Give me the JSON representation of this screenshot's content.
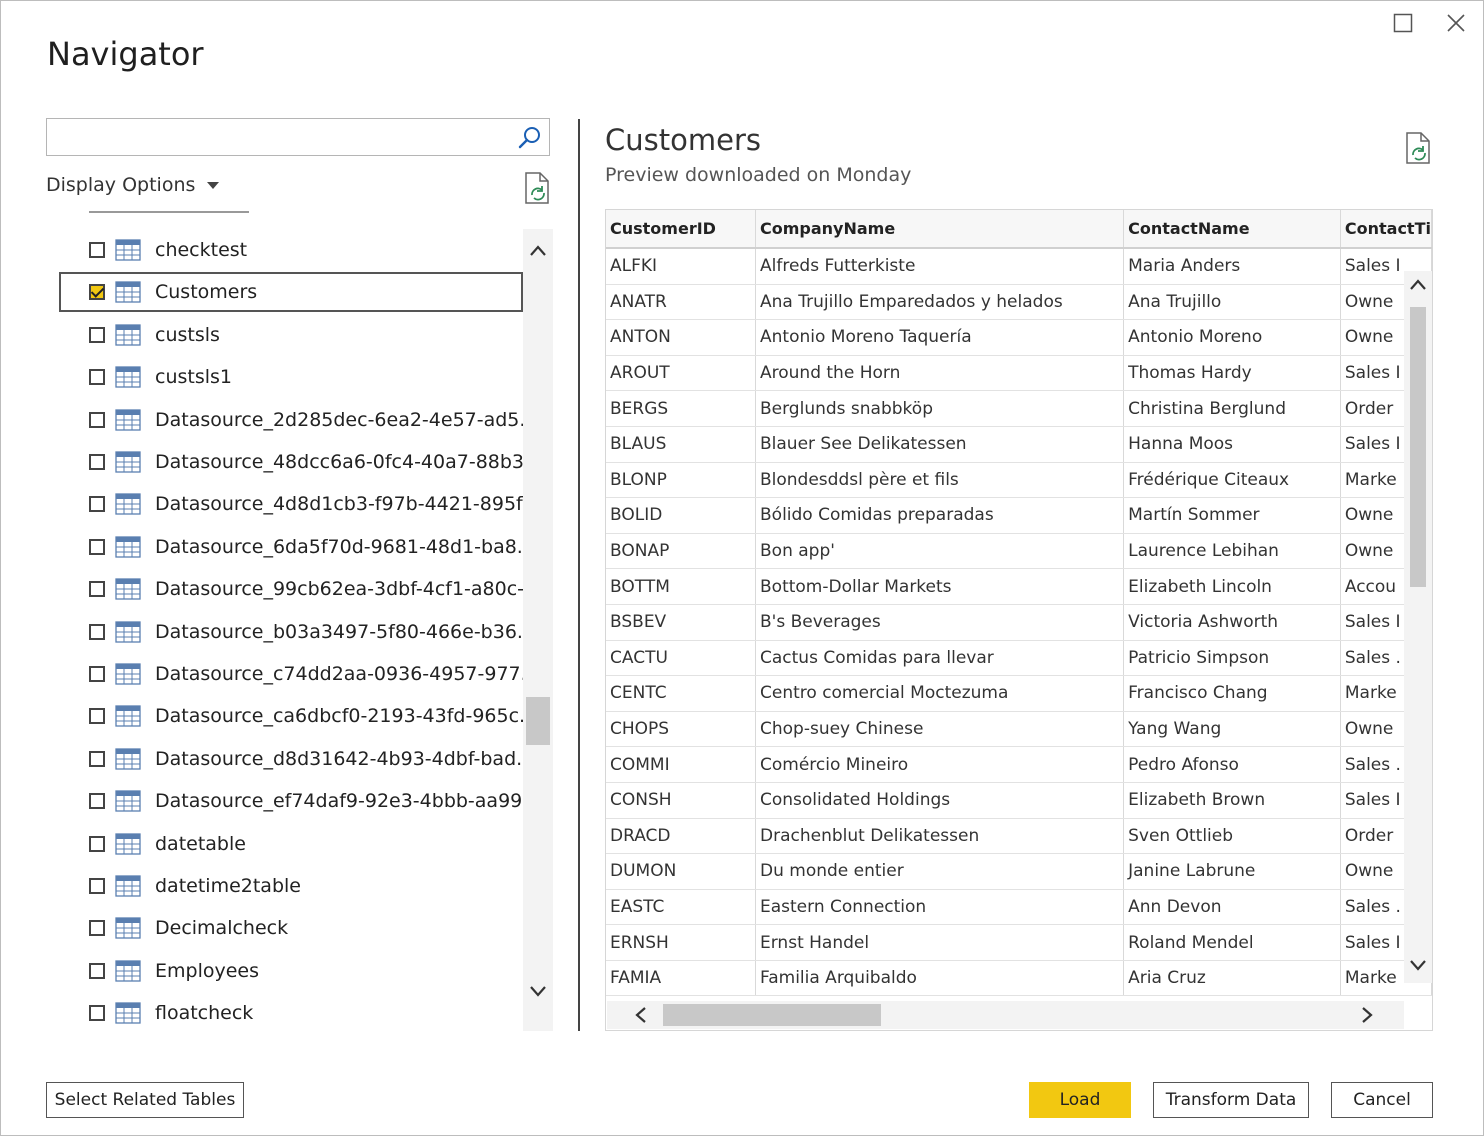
{
  "window": {
    "title": "Navigator",
    "maximize_icon": "maximize-icon",
    "close_icon": "close-icon"
  },
  "search": {
    "value": "",
    "placeholder": "",
    "icon": "search-icon"
  },
  "display_options": {
    "label": "Display Options",
    "icon": "chevron-down-icon"
  },
  "tree": {
    "item_icon": "table-icon",
    "items": [
      {
        "label": "checktest",
        "checked": false,
        "selected": false
      },
      {
        "label": "Customers",
        "checked": true,
        "selected": true
      },
      {
        "label": "custsls",
        "checked": false,
        "selected": false
      },
      {
        "label": "custsls1",
        "checked": false,
        "selected": false
      },
      {
        "label": "Datasource_2d285dec-6ea2-4e57-ad5...",
        "checked": false,
        "selected": false
      },
      {
        "label": "Datasource_48dcc6a6-0fc4-40a7-88b3...",
        "checked": false,
        "selected": false
      },
      {
        "label": "Datasource_4d8d1cb3-f97b-4421-895f...",
        "checked": false,
        "selected": false
      },
      {
        "label": "Datasource_6da5f70d-9681-48d1-ba8...",
        "checked": false,
        "selected": false
      },
      {
        "label": "Datasource_99cb62ea-3dbf-4cf1-a80c-...",
        "checked": false,
        "selected": false
      },
      {
        "label": "Datasource_b03a3497-5f80-466e-b36...",
        "checked": false,
        "selected": false
      },
      {
        "label": "Datasource_c74dd2aa-0936-4957-977...",
        "checked": false,
        "selected": false
      },
      {
        "label": "Datasource_ca6dbcf0-2193-43fd-965c...",
        "checked": false,
        "selected": false
      },
      {
        "label": "Datasource_d8d31642-4b93-4dbf-bad...",
        "checked": false,
        "selected": false
      },
      {
        "label": "Datasource_ef74daf9-92e3-4bbb-aa99...",
        "checked": false,
        "selected": false
      },
      {
        "label": "datetable",
        "checked": false,
        "selected": false
      },
      {
        "label": "datetime2table",
        "checked": false,
        "selected": false
      },
      {
        "label": "Decimalcheck",
        "checked": false,
        "selected": false
      },
      {
        "label": "Employees",
        "checked": false,
        "selected": false
      },
      {
        "label": "floatcheck",
        "checked": false,
        "selected": false
      }
    ]
  },
  "preview": {
    "title": "Customers",
    "subtitle": "Preview downloaded on Monday",
    "refresh_icon": "refresh-file-icon",
    "columns": [
      "CustomerID",
      "CompanyName",
      "ContactName",
      "ContactTi"
    ],
    "rows": [
      [
        "ALFKI",
        "Alfreds Futterkiste",
        "Maria Anders",
        "Sales I"
      ],
      [
        "ANATR",
        "Ana Trujillo Emparedados y helados",
        "Ana Trujillo",
        "Owne"
      ],
      [
        "ANTON",
        "Antonio Moreno Taquería",
        "Antonio Moreno",
        "Owne"
      ],
      [
        "AROUT",
        "Around the Horn",
        "Thomas Hardy",
        "Sales I"
      ],
      [
        "BERGS",
        "Berglunds snabbköp",
        "Christina Berglund",
        "Order"
      ],
      [
        "BLAUS",
        "Blauer See Delikatessen",
        "Hanna Moos",
        "Sales I"
      ],
      [
        "BLONP",
        "Blondesddsl père et fils",
        "Frédérique Citeaux",
        "Marke"
      ],
      [
        "BOLID",
        "Bólido Comidas preparadas",
        "Martín Sommer",
        "Owne"
      ],
      [
        "BONAP",
        "Bon app'",
        "Laurence Lebihan",
        "Owne"
      ],
      [
        "BOTTM",
        "Bottom-Dollar Markets",
        "Elizabeth Lincoln",
        "Accou"
      ],
      [
        "BSBEV",
        "B's Beverages",
        "Victoria Ashworth",
        "Sales I"
      ],
      [
        "CACTU",
        "Cactus Comidas para llevar",
        "Patricio Simpson",
        "Sales ."
      ],
      [
        "CENTC",
        "Centro comercial Moctezuma",
        "Francisco Chang",
        "Marke"
      ],
      [
        "CHOPS",
        "Chop-suey Chinese",
        "Yang Wang",
        "Owne"
      ],
      [
        "COMMI",
        "Comércio Mineiro",
        "Pedro Afonso",
        "Sales ."
      ],
      [
        "CONSH",
        "Consolidated Holdings",
        "Elizabeth Brown",
        "Sales I"
      ],
      [
        "DRACD",
        "Drachenblut Delikatessen",
        "Sven Ottlieb",
        "Order"
      ],
      [
        "DUMON",
        "Du monde entier",
        "Janine Labrune",
        "Owne"
      ],
      [
        "EASTC",
        "Eastern Connection",
        "Ann Devon",
        "Sales ."
      ],
      [
        "ERNSH",
        "Ernst Handel",
        "Roland Mendel",
        "Sales I"
      ],
      [
        "FAMIA",
        "Familia Arquibaldo",
        "Aria Cruz",
        "Marke"
      ]
    ]
  },
  "buttons": {
    "select_related": "Select Related Tables",
    "load": "Load",
    "transform": "Transform Data",
    "cancel": "Cancel"
  },
  "colors": {
    "accent": "#f2c811",
    "border": "#555555"
  }
}
